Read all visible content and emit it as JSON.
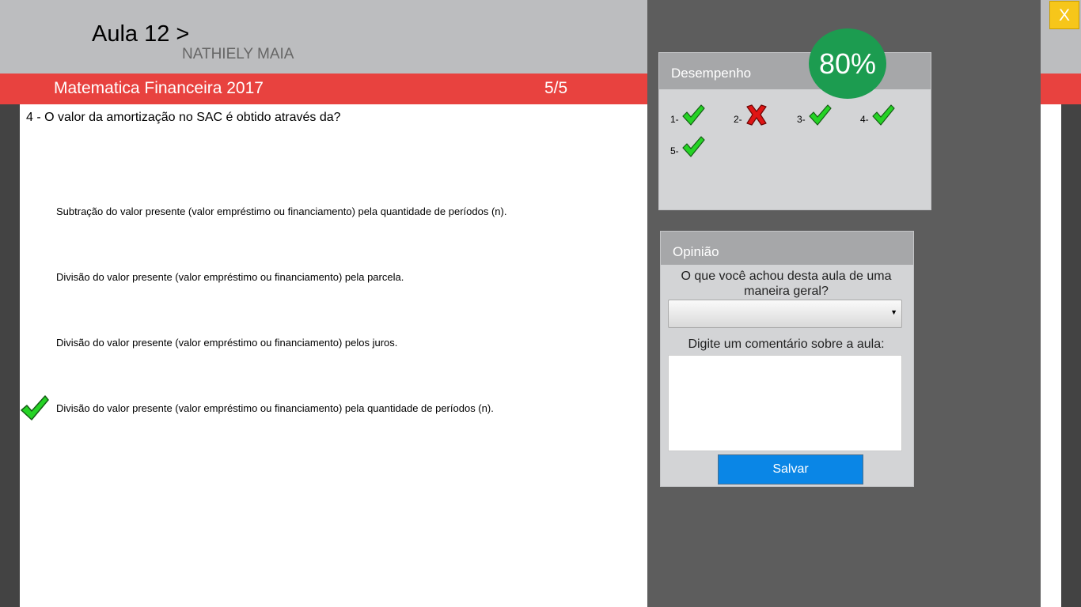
{
  "header": {
    "lesson_title": "Aula 12 >",
    "student_name": "NATHIELY MAIA",
    "course_title": "Matematica Financeira 2017",
    "progress": "5/5"
  },
  "question": {
    "text": "4 - O valor da amortização no SAC é obtido através da?",
    "options": [
      {
        "label": "Subtração do valor presente (valor empréstimo ou financiamento) pela quantidade de períodos (n).",
        "selected_correct": false
      },
      {
        "label": "Divisão do valor presente (valor empréstimo ou financiamento) pela parcela.",
        "selected_correct": false
      },
      {
        "label": "Divisão do valor presente (valor empréstimo ou financiamento) pelos juros.",
        "selected_correct": false
      },
      {
        "label": "Divisão do valor presente (valor empréstimo ou financiamento) pela quantidade de períodos (n).",
        "selected_correct": true
      }
    ],
    "correct_icon": "check-icon"
  },
  "close_button": {
    "label": "X"
  },
  "performance": {
    "title": "Desempenho",
    "score": "80%",
    "results": [
      {
        "label": "1-",
        "status": "correct",
        "icon": "check-icon"
      },
      {
        "label": "2-",
        "status": "wrong",
        "icon": "cross-icon"
      },
      {
        "label": "3-",
        "status": "correct",
        "icon": "check-icon"
      },
      {
        "label": "4-",
        "status": "correct",
        "icon": "check-icon"
      },
      {
        "label": "5-",
        "status": "correct",
        "icon": "check-icon"
      }
    ]
  },
  "opinion": {
    "title": "Opinião",
    "question": "O que você achou desta aula de uma maneira geral?",
    "select_value": "",
    "comment_label": "Digite um comentário sobre a aula:",
    "comment_value": "",
    "save_label": "Salvar"
  },
  "colors": {
    "accent_red": "#e8423f",
    "score_green": "#1c9c50",
    "save_blue": "#0a86e6",
    "close_yellow": "#f6c61a",
    "overlay_gray": "#5d5d5d"
  }
}
